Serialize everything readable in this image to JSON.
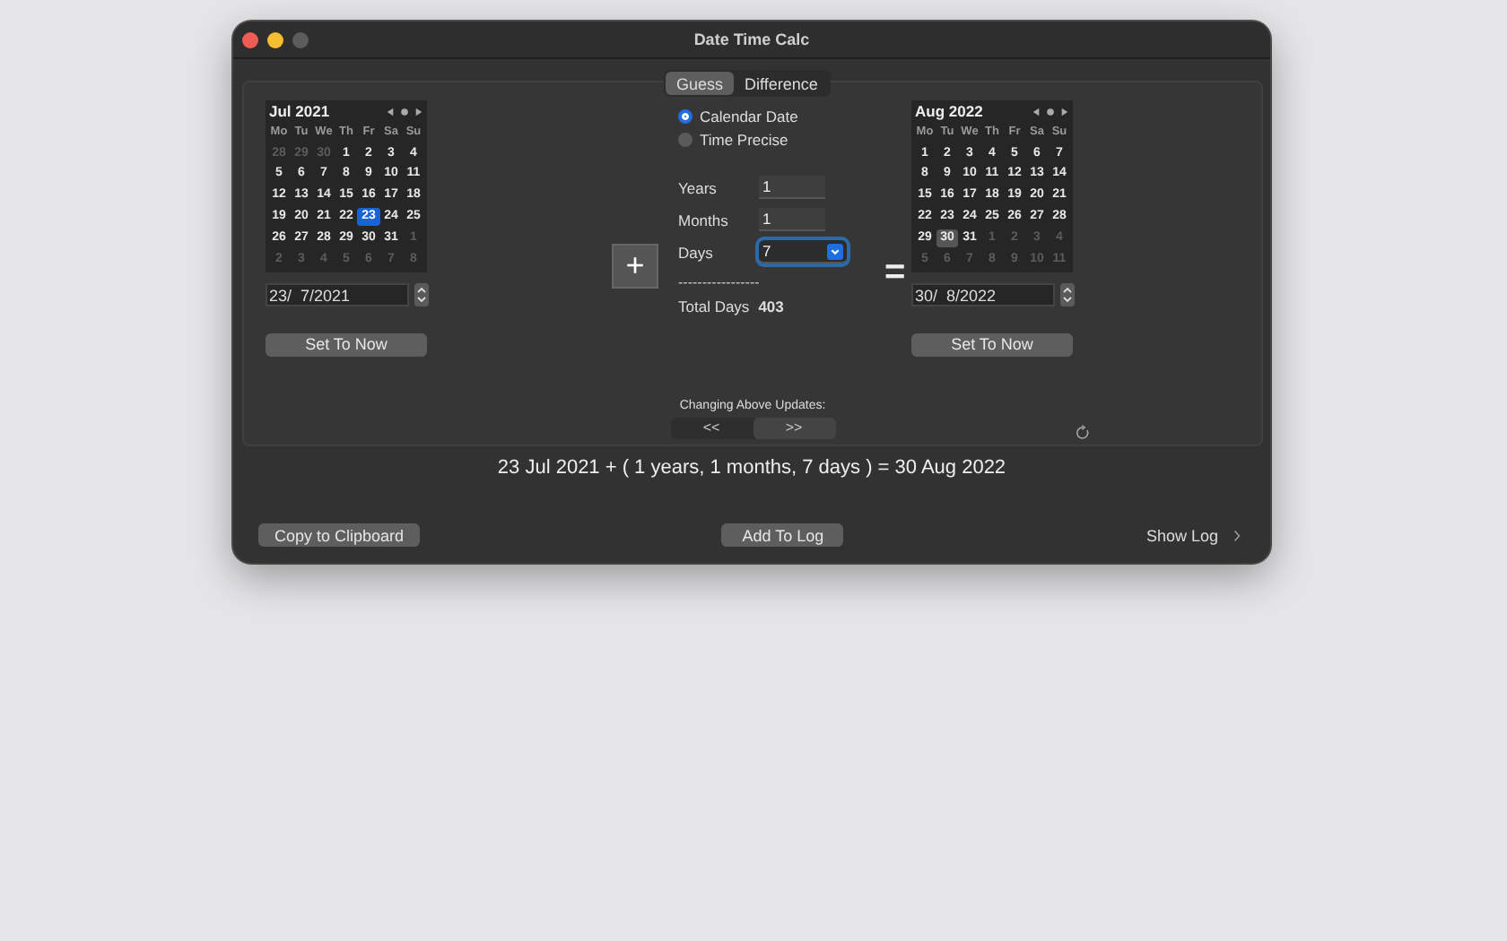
{
  "window": {
    "title": "Date Time Calc"
  },
  "mode_tabs": [
    {
      "label": "Guess",
      "selected": true
    },
    {
      "label": "Difference",
      "selected": false
    }
  ],
  "calendars": [
    {
      "title": "Jul 2021",
      "focused": true,
      "date_value": "23/  7/2021",
      "button": "Set To Now",
      "weekdays": [
        "Mo",
        "Tu",
        "We",
        "Th",
        "Fr",
        "Sa",
        "Su"
      ],
      "weeks": [
        [
          {
            "label": "28",
            "muted": true,
            "selected": false
          },
          {
            "label": "29",
            "muted": true,
            "selected": false
          },
          {
            "label": "30",
            "muted": true,
            "selected": false
          },
          {
            "label": "1",
            "muted": false,
            "selected": false
          },
          {
            "label": "2",
            "muted": false,
            "selected": false
          },
          {
            "label": "3",
            "muted": false,
            "selected": false
          },
          {
            "label": "4",
            "muted": false,
            "selected": false
          }
        ],
        [
          {
            "label": "5",
            "muted": false,
            "selected": false
          },
          {
            "label": "6",
            "muted": false,
            "selected": false
          },
          {
            "label": "7",
            "muted": false,
            "selected": false
          },
          {
            "label": "8",
            "muted": false,
            "selected": false
          },
          {
            "label": "9",
            "muted": false,
            "selected": false
          },
          {
            "label": "10",
            "muted": false,
            "selected": false
          },
          {
            "label": "11",
            "muted": false,
            "selected": false
          }
        ],
        [
          {
            "label": "12",
            "muted": false,
            "selected": false
          },
          {
            "label": "13",
            "muted": false,
            "selected": false
          },
          {
            "label": "14",
            "muted": false,
            "selected": false
          },
          {
            "label": "15",
            "muted": false,
            "selected": false
          },
          {
            "label": "16",
            "muted": false,
            "selected": false
          },
          {
            "label": "17",
            "muted": false,
            "selected": false
          },
          {
            "label": "18",
            "muted": false,
            "selected": false
          }
        ],
        [
          {
            "label": "19",
            "muted": false,
            "selected": false
          },
          {
            "label": "20",
            "muted": false,
            "selected": false
          },
          {
            "label": "21",
            "muted": false,
            "selected": false
          },
          {
            "label": "22",
            "muted": false,
            "selected": false
          },
          {
            "label": "23",
            "muted": false,
            "selected": true
          },
          {
            "label": "24",
            "muted": false,
            "selected": false
          },
          {
            "label": "25",
            "muted": false,
            "selected": false
          }
        ],
        [
          {
            "label": "26",
            "muted": false,
            "selected": false
          },
          {
            "label": "27",
            "muted": false,
            "selected": false
          },
          {
            "label": "28",
            "muted": false,
            "selected": false
          },
          {
            "label": "29",
            "muted": false,
            "selected": false
          },
          {
            "label": "30",
            "muted": false,
            "selected": false
          },
          {
            "label": "31",
            "muted": false,
            "selected": false
          },
          {
            "label": "1",
            "muted": true,
            "selected": false
          }
        ],
        [
          {
            "label": "2",
            "muted": true,
            "selected": false
          },
          {
            "label": "3",
            "muted": true,
            "selected": false
          },
          {
            "label": "4",
            "muted": true,
            "selected": false
          },
          {
            "label": "5",
            "muted": true,
            "selected": false
          },
          {
            "label": "6",
            "muted": true,
            "selected": false
          },
          {
            "label": "7",
            "muted": true,
            "selected": false
          },
          {
            "label": "8",
            "muted": true,
            "selected": false
          }
        ]
      ]
    },
    {
      "title": "Aug 2022",
      "focused": false,
      "date_value": "30/  8/2022",
      "button": "Set To Now",
      "weekdays": [
        "Mo",
        "Tu",
        "We",
        "Th",
        "Fr",
        "Sa",
        "Su"
      ],
      "weeks": [
        [
          {
            "label": "1",
            "muted": false,
            "selected": false
          },
          {
            "label": "2",
            "muted": false,
            "selected": false
          },
          {
            "label": "3",
            "muted": false,
            "selected": false
          },
          {
            "label": "4",
            "muted": false,
            "selected": false
          },
          {
            "label": "5",
            "muted": false,
            "selected": false
          },
          {
            "label": "6",
            "muted": false,
            "selected": false
          },
          {
            "label": "7",
            "muted": false,
            "selected": false
          }
        ],
        [
          {
            "label": "8",
            "muted": false,
            "selected": false
          },
          {
            "label": "9",
            "muted": false,
            "selected": false
          },
          {
            "label": "10",
            "muted": false,
            "selected": false
          },
          {
            "label": "11",
            "muted": false,
            "selected": false
          },
          {
            "label": "12",
            "muted": false,
            "selected": false
          },
          {
            "label": "13",
            "muted": false,
            "selected": false
          },
          {
            "label": "14",
            "muted": false,
            "selected": false
          }
        ],
        [
          {
            "label": "15",
            "muted": false,
            "selected": false
          },
          {
            "label": "16",
            "muted": false,
            "selected": false
          },
          {
            "label": "17",
            "muted": false,
            "selected": false
          },
          {
            "label": "18",
            "muted": false,
            "selected": false
          },
          {
            "label": "19",
            "muted": false,
            "selected": false
          },
          {
            "label": "20",
            "muted": false,
            "selected": false
          },
          {
            "label": "21",
            "muted": false,
            "selected": false
          }
        ],
        [
          {
            "label": "22",
            "muted": false,
            "selected": false
          },
          {
            "label": "23",
            "muted": false,
            "selected": false
          },
          {
            "label": "24",
            "muted": false,
            "selected": false
          },
          {
            "label": "25",
            "muted": false,
            "selected": false
          },
          {
            "label": "26",
            "muted": false,
            "selected": false
          },
          {
            "label": "27",
            "muted": false,
            "selected": false
          },
          {
            "label": "28",
            "muted": false,
            "selected": false
          }
        ],
        [
          {
            "label": "29",
            "muted": false,
            "selected": false
          },
          {
            "label": "30",
            "muted": false,
            "selected": true
          },
          {
            "label": "31",
            "muted": false,
            "selected": false
          },
          {
            "label": "1",
            "muted": true,
            "selected": false
          },
          {
            "label": "2",
            "muted": true,
            "selected": false
          },
          {
            "label": "3",
            "muted": true,
            "selected": false
          },
          {
            "label": "4",
            "muted": true,
            "selected": false
          }
        ],
        [
          {
            "label": "5",
            "muted": true,
            "selected": false
          },
          {
            "label": "6",
            "muted": true,
            "selected": false
          },
          {
            "label": "7",
            "muted": true,
            "selected": false
          },
          {
            "label": "8",
            "muted": true,
            "selected": false
          },
          {
            "label": "9",
            "muted": true,
            "selected": false
          },
          {
            "label": "10",
            "muted": true,
            "selected": false
          },
          {
            "label": "11",
            "muted": true,
            "selected": false
          }
        ]
      ]
    }
  ],
  "radios": [
    {
      "label": "Calendar Date",
      "selected": true
    },
    {
      "label": "Time Precise",
      "selected": false
    }
  ],
  "operator": "+",
  "equals": "=",
  "fields": [
    {
      "label": "Years",
      "value": "1",
      "focused": false
    },
    {
      "label": "Months",
      "value": "1",
      "focused": false
    },
    {
      "label": "Days",
      "value": "7",
      "focused": true
    }
  ],
  "separator": "-----------------",
  "total": {
    "label": "Total Days",
    "value": "403"
  },
  "updates": {
    "label": "Changing Above Updates:",
    "options": [
      {
        "label": "<<",
        "selected": false
      },
      {
        "label": ">>",
        "selected": true
      }
    ]
  },
  "result": "23 Jul 2021 + ( 1 years, 1 months, 7 days ) = 30 Aug 2022",
  "footer": {
    "copy": "Copy to Clipboard",
    "add": "Add To Log",
    "show_log": "Show Log"
  }
}
